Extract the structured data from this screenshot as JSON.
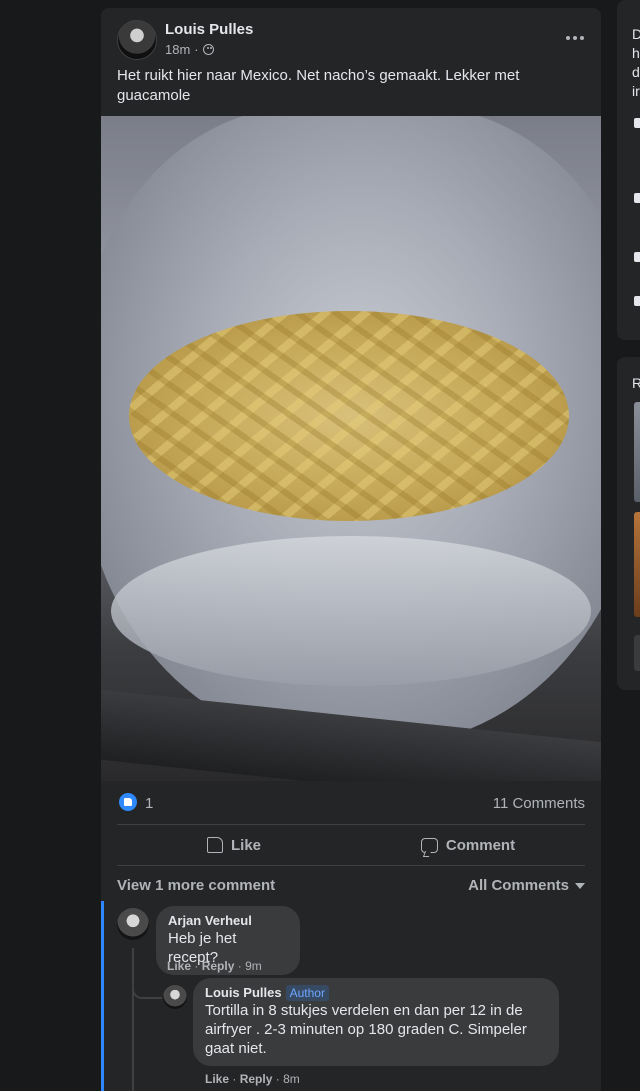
{
  "post": {
    "author": "Louis Pulles",
    "time": "18m",
    "privacy_icon": "friends-icon",
    "text": "Het ruikt hier naar Mexico. Net nacho’s gemaakt. Lekker met guacamole",
    "photo_icon": "photo-nachos-in-plastic-bag"
  },
  "reactions": {
    "like_count": "1",
    "comments_count": "11 Comments"
  },
  "actions": {
    "like_label": "Like",
    "comment_label": "Comment"
  },
  "comments_section": {
    "view_more": "View 1 more comment",
    "sort_label": "All Comments"
  },
  "comments": [
    {
      "author": "Arjan Verheul",
      "text": "Heb je het recept?",
      "like": "Like",
      "reply": "Reply",
      "time": "9m"
    }
  ],
  "replies": [
    {
      "author": "Louis Pulles",
      "badge": "Author",
      "text": "Tortilla in 8 stukjes verdelen en dan per 12 in de airfryer . 2-3 minuten op 180 graden C. Simpeler gaat niet.",
      "like": "Like",
      "reply": "Reply",
      "time": "8m"
    }
  ],
  "sidebar": {
    "fragments": [
      "D",
      "h",
      "d",
      "ir"
    ],
    "header_fragment": "R"
  },
  "colors": {
    "background": "#18191a",
    "card": "#242526",
    "accent": "#2d88ff",
    "text_primary": "#e4e6eb",
    "text_secondary": "#b0b3b8"
  }
}
